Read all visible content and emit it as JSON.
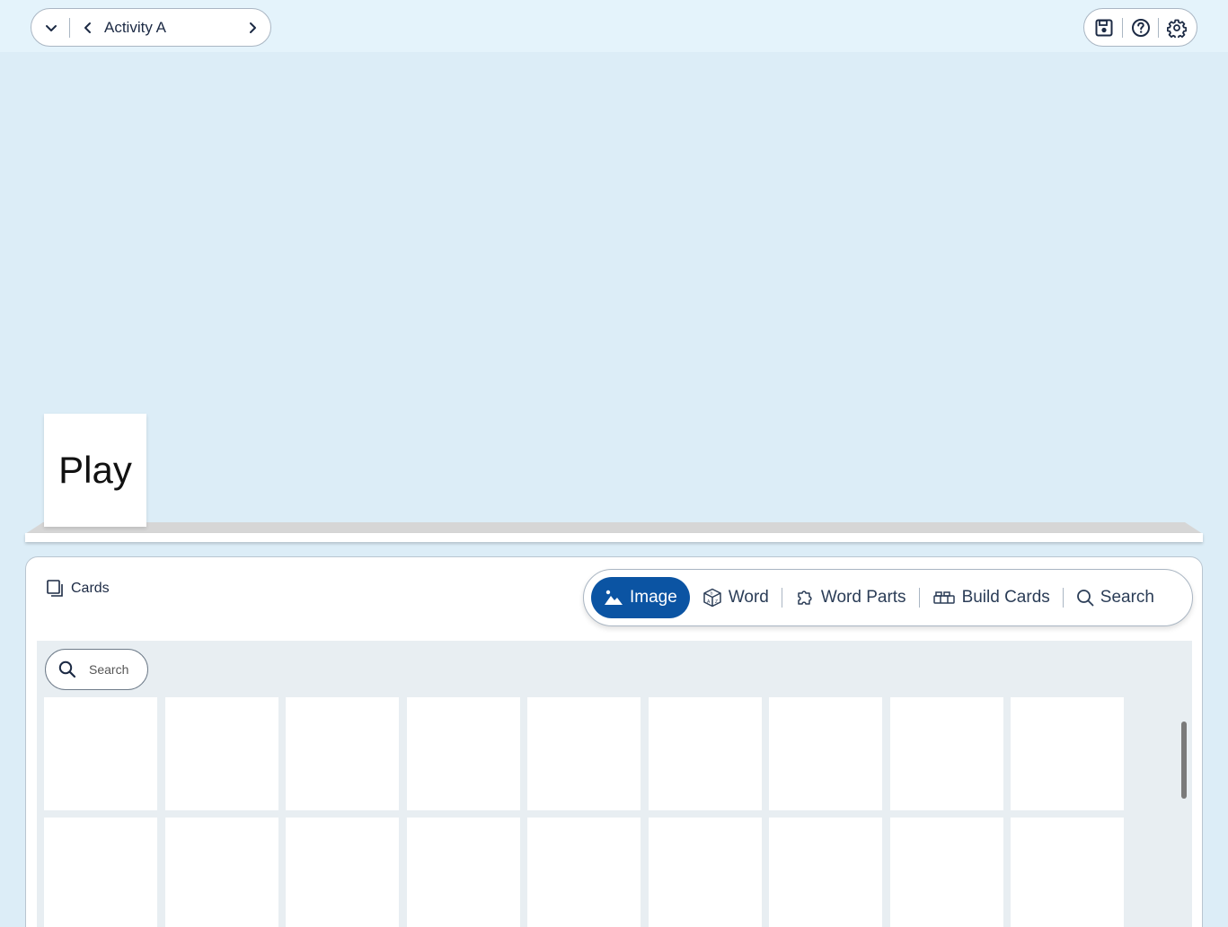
{
  "header": {
    "activity_title": "Activity A"
  },
  "shelf": {
    "play_card_label": "Play"
  },
  "panel": {
    "cards_label": "Cards",
    "tabs": [
      {
        "label": "Image",
        "icon": "image-icon",
        "active": true
      },
      {
        "label": "Word",
        "icon": "dice-icon",
        "active": false
      },
      {
        "label": "Word Parts",
        "icon": "puzzle-icon",
        "active": false
      },
      {
        "label": "Build Cards",
        "icon": "build-cards-icon",
        "active": false
      },
      {
        "label": "Search",
        "icon": "search-icon",
        "active": false
      }
    ],
    "search_placeholder": "Search"
  },
  "colors": {
    "background": "#dcedf7",
    "accent": "#0b54a3"
  }
}
